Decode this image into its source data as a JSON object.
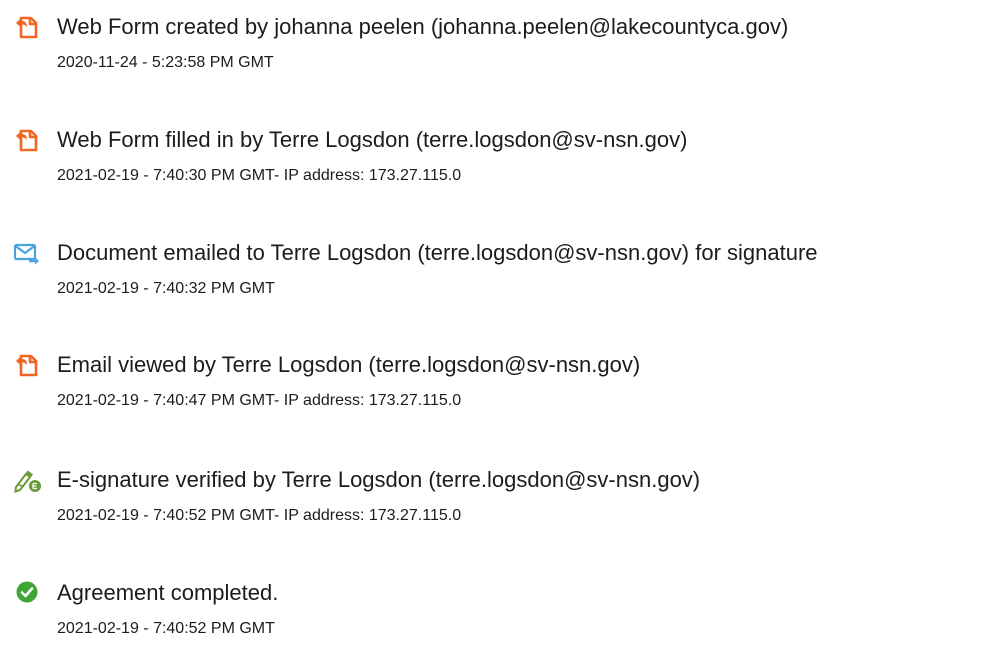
{
  "events": [
    {
      "icon": "document-form-icon",
      "text": "Web Form created by johanna peelen (johanna.peelen@lakecountyca.gov)",
      "detail": "2020-11-24 - 5:23:58 PM GMT"
    },
    {
      "icon": "document-form-icon",
      "text": "Web Form filled in by Terre Logsdon (terre.logsdon@sv-nsn.gov)",
      "detail": "2021-02-19 - 7:40:30 PM GMT- IP address: 173.27.115.0"
    },
    {
      "icon": "email-sent-icon",
      "text": "Document emailed to Terre Logsdon (terre.logsdon@sv-nsn.gov) for signature",
      "detail": "2021-02-19 - 7:40:32 PM GMT"
    },
    {
      "icon": "document-form-icon",
      "text": "Email viewed by Terre Logsdon (terre.logsdon@sv-nsn.gov)",
      "detail": "2021-02-19 - 7:40:47 PM GMT- IP address: 173.27.115.0"
    },
    {
      "icon": "esignature-pen-icon",
      "text": "E-signature verified by Terre Logsdon (terre.logsdon@sv-nsn.gov)",
      "detail": "2021-02-19 - 7:40:52 PM GMT- IP address: 173.27.115.0"
    },
    {
      "icon": "check-circle-icon",
      "text": "Agreement completed.",
      "detail": "2021-02-19 - 7:40:52 PM GMT"
    }
  ],
  "colors": {
    "document_icon": "#f26522",
    "email_icon": "#4aa3df",
    "pen_icon": "#6a9a3a",
    "check_icon": "#3fa635",
    "text": "#1c1c1c"
  }
}
